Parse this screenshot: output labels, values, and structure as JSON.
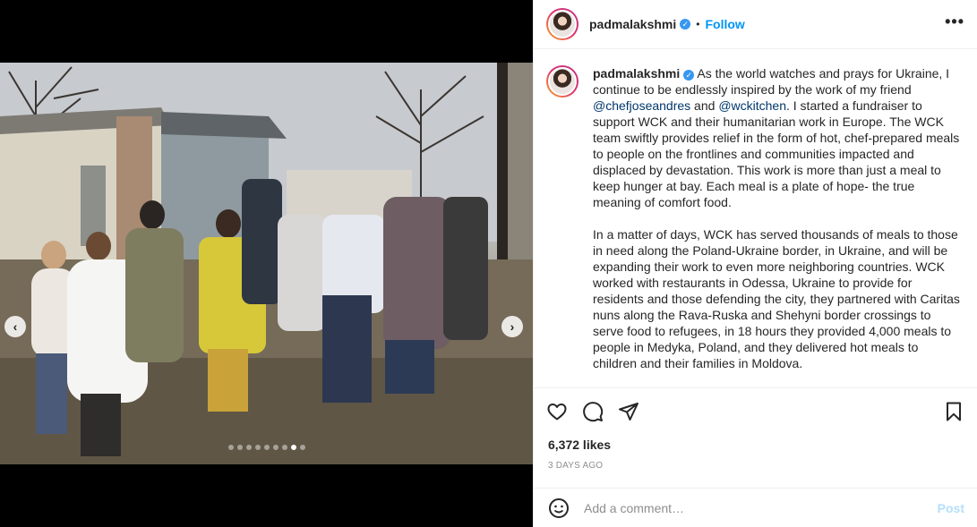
{
  "post": {
    "username": "padmalakshmi",
    "verified_badge": "✓",
    "separator": "•",
    "follow_label": "Follow",
    "more_icon": "•••",
    "caption": {
      "p1_before": "As the world watches and prays for Ukraine, I continue to be endlessly inspired by the work of my friend ",
      "mention1": "@chefjoseandres",
      "p1_and": " and ",
      "mention2": "@wckitchen",
      "p1_after": ". I started a fundraiser to support WCK and their humanitarian work in Europe. The WCK team swiftly provides relief in the form of hot, chef-prepared meals to people on the frontlines and communities impacted and displaced by devastation. This work is more than just a meal to keep hunger at bay. Each meal is a plate of hope- the true meaning of comfort food.",
      "p2": "In a matter of days, WCK has served thousands of meals to those in need along the Poland-Ukraine border, in Ukraine, and will be expanding their work to even more neighboring countries. WCK worked with restaurants in Odessa, Ukraine to provide for residents and those defending the city, they partnered with Caritas nuns along the Rava-Ruska and Shehyni border crossings to serve food to refugees, in 18 hours they provided 4,000 meals to people in Medyka, Poland, and they delivered hot meals to children and their families in Moldova."
    },
    "likes": "6,372 likes",
    "time": "3 DAYS AGO",
    "comment_placeholder": "Add a comment…",
    "post_label": "Post"
  },
  "carousel": {
    "prev_icon": "‹",
    "next_icon": "›",
    "slide_count": 9,
    "active_index": 7
  },
  "colors": {
    "accent": "#0095f6",
    "mention": "#00376b",
    "verified": "#3897f0",
    "muted": "#8e8e8e",
    "post_disabled": "#b2dffc"
  },
  "icons": {
    "heart": "heart-icon",
    "comment": "comment-icon",
    "share": "paper-plane-icon",
    "save": "bookmark-icon",
    "emoji": "smiley-icon"
  }
}
